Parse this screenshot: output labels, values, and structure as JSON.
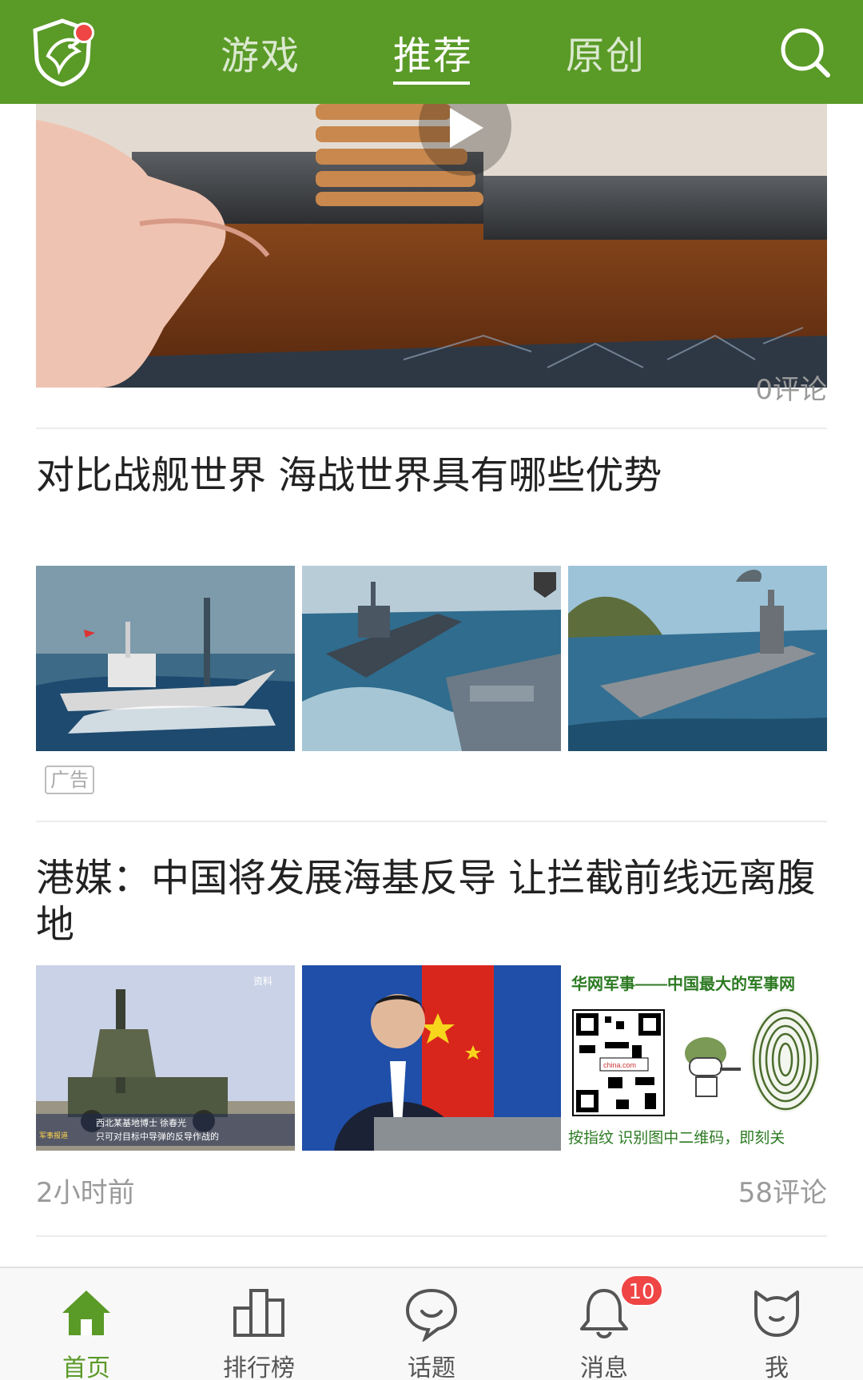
{
  "header": {
    "tabs": [
      {
        "label": "游戏",
        "active": false
      },
      {
        "label": "推荐",
        "active": true
      },
      {
        "label": "原创",
        "active": false
      }
    ],
    "icons": {
      "logo": "shield-eagle-logo",
      "search": "search-icon"
    },
    "notification_dot": true
  },
  "feed": {
    "items": [
      {
        "type": "video",
        "comments": "0评论"
      },
      {
        "type": "ad",
        "title": "对比战舰世界 海战世界具有哪些优势",
        "ad_label": "广告"
      },
      {
        "type": "article",
        "title": "港媒：中国将发展海基反导 让拦截前线远离腹地",
        "time": "2小时前",
        "comments": "58评论",
        "thumb3_texts": {
          "top": "华网军事——中国最大的军事网",
          "bottom": "按指纹 识别图中二维码，即刻关",
          "qr_caption": "china.com"
        },
        "thumb1_texts": {
          "corner": "资料",
          "caption1": "西北某基地博士 徐春光",
          "caption2": "只可对目标中导弹的反导作战的",
          "channel": "军事报道"
        }
      }
    ]
  },
  "bottom_nav": {
    "items": [
      {
        "label": "首页",
        "icon": "home-icon",
        "active": true
      },
      {
        "label": "排行榜",
        "icon": "ranking-icon",
        "active": false
      },
      {
        "label": "话题",
        "icon": "chat-bubble-icon",
        "active": false
      },
      {
        "label": "消息",
        "icon": "bell-icon",
        "active": false,
        "badge": "10"
      },
      {
        "label": "我",
        "icon": "cat-face-icon",
        "active": false
      }
    ]
  },
  "colors": {
    "brand_green": "#5a9a27",
    "badge_red": "#f04545",
    "meta_gray": "#9a9a9a"
  }
}
